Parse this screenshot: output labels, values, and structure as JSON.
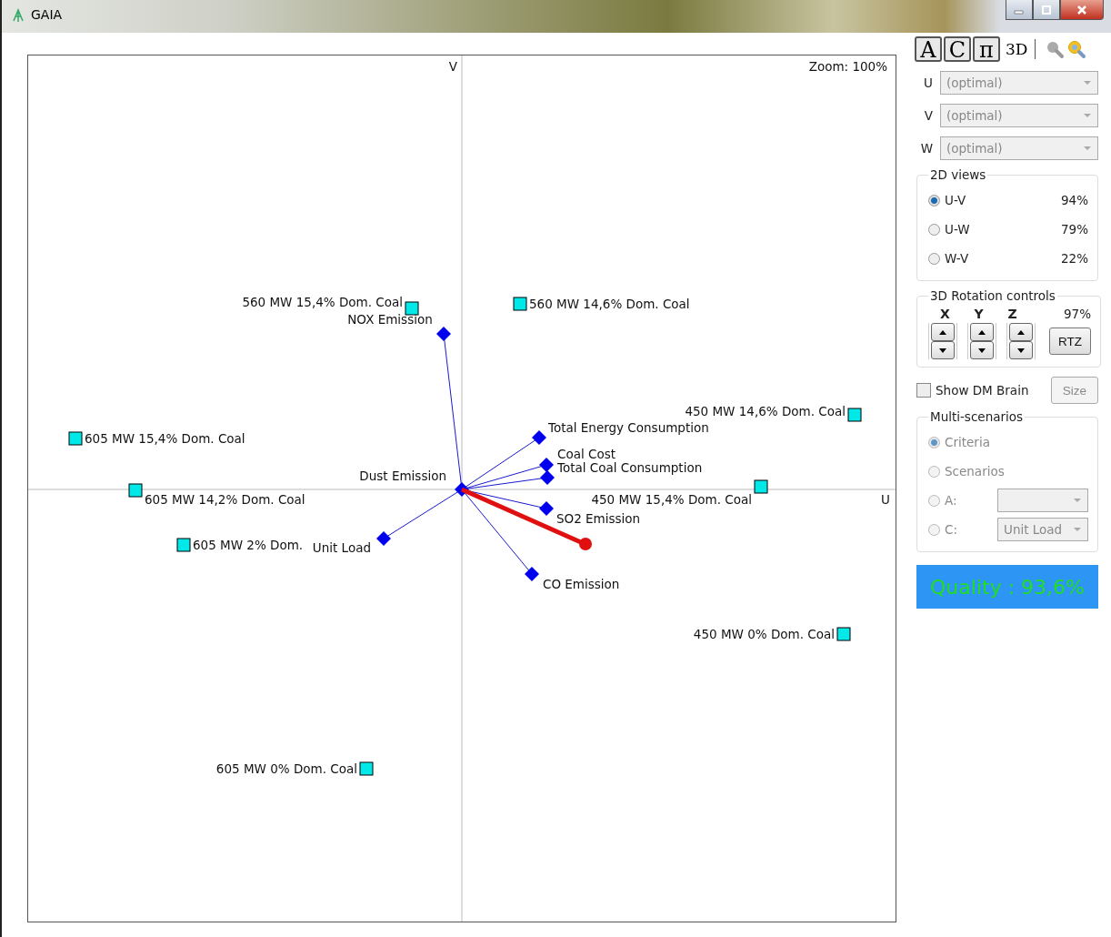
{
  "window": {
    "title": "GAIA"
  },
  "plot": {
    "zoom": "Zoom: 100%",
    "axis_v": "V",
    "axis_u": "U",
    "alternatives": [
      {
        "label": "560 MW 15,4% Dom. Coal"
      },
      {
        "label": "560 MW 14,6% Dom. Coal"
      },
      {
        "label": "450 MW 14,6% Dom. Coal"
      },
      {
        "label": "605 MW 15,4% Dom. Coal"
      },
      {
        "label": "605 MW 14,2% Dom. Coal"
      },
      {
        "label": "450 MW 15,4% Dom. Coal"
      },
      {
        "label": "605 MW 2% Dom."
      },
      {
        "label": "450 MW 0% Dom. Coal"
      },
      {
        "label": "605 MW 0% Dom. Coal"
      }
    ],
    "criteria": [
      {
        "label": "NOX Emission"
      },
      {
        "label": "Total Energy Consumption"
      },
      {
        "label": "Coal Cost"
      },
      {
        "label": "Total Coal Consumption"
      },
      {
        "label": "SO2 Emission"
      },
      {
        "label": "CO Emission"
      },
      {
        "label": "Unit Load"
      },
      {
        "label": "Dust Emission"
      }
    ]
  },
  "toolbar": {
    "buttons": [
      {
        "label": "A",
        "kind": "framed"
      },
      {
        "label": "C",
        "kind": "framed"
      },
      {
        "label": "π",
        "kind": "framed"
      },
      {
        "label": "3D",
        "kind": "plain"
      }
    ]
  },
  "axis_selectors": [
    {
      "label": "U",
      "value": "(optimal)",
      "disabled": true
    },
    {
      "label": "V",
      "value": "(optimal)",
      "disabled": true
    },
    {
      "label": "W",
      "value": "(optimal)",
      "disabled": true
    }
  ],
  "views_2d": {
    "title": "2D views",
    "options": [
      {
        "label": "U-V",
        "percent": "94%",
        "selected": true
      },
      {
        "label": "U-W",
        "percent": "79%",
        "selected": false
      },
      {
        "label": "W-V",
        "percent": "22%",
        "selected": false
      }
    ]
  },
  "rotation": {
    "title": "3D Rotation controls",
    "axes": [
      "X",
      "Y",
      "Z"
    ],
    "percent": "97%",
    "reset": "RTZ"
  },
  "dm_brain": {
    "label": "Show DM Brain",
    "checked": false,
    "size_button": "Size",
    "size_disabled": true
  },
  "multi_scenarios": {
    "title": "Multi-scenarios",
    "disabled": true,
    "options": [
      {
        "kind": "radio",
        "label": "Criteria",
        "selected": true
      },
      {
        "kind": "radio",
        "label": "Scenarios",
        "selected": false
      },
      {
        "kind": "select",
        "label": "A:",
        "selected": false
      },
      {
        "kind": "select",
        "label": "C:",
        "selected": false,
        "value": "Unit Load"
      }
    ]
  },
  "quality": "Quality : 93,6%"
}
